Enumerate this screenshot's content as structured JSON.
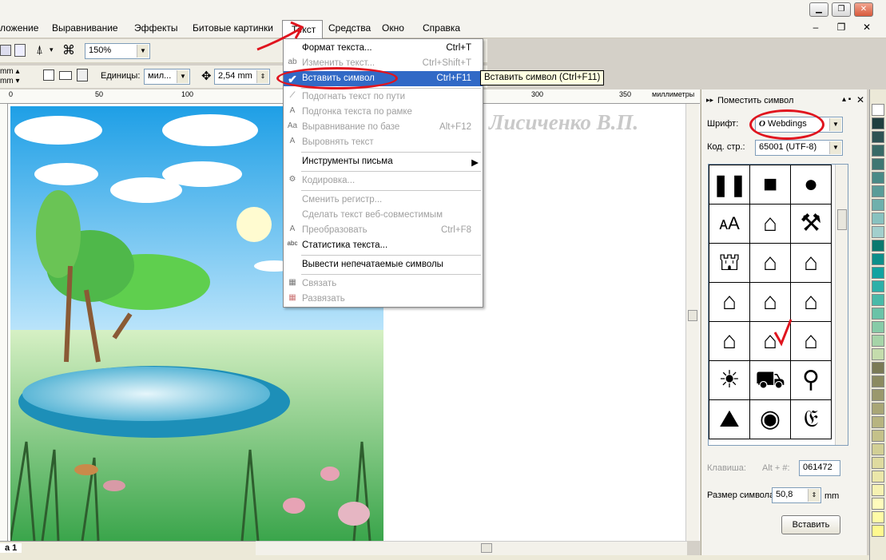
{
  "menubar": {
    "items": [
      "ложение",
      "Выравнивание",
      "Эффекты",
      "Битовые картинки",
      "Текст",
      "Средства",
      "Окно",
      "Справка"
    ]
  },
  "toolbar": {
    "zoom": "150%",
    "units_label": "Единицы:",
    "units_value": "мил...",
    "nudge_value": "2,54 mm"
  },
  "ruler": {
    "labels": [
      "0",
      "50",
      "100",
      "300",
      "350"
    ],
    "unit": "миллиметры"
  },
  "canvas": {
    "watermark": "Лисиченко В.П.",
    "page_tab": "а 1"
  },
  "text_menu": {
    "items": [
      {
        "label": "Формат текста...",
        "shortcut": "Ctrl+T",
        "disabled": false
      },
      {
        "label": "Изменить текст...",
        "shortcut": "Ctrl+Shift+T",
        "disabled": true
      },
      {
        "label": "Вставить символ",
        "shortcut": "Ctrl+F11",
        "highlighted": true
      },
      {
        "label": "Подогнать текст по пути",
        "shortcut": "",
        "disabled": true
      },
      {
        "label": "Подгонка текста по рамке",
        "shortcut": "",
        "disabled": true
      },
      {
        "label": "Выравнивание по базе",
        "shortcut": "Alt+F12",
        "disabled": true
      },
      {
        "label": "Выровнять текст",
        "shortcut": "",
        "disabled": true
      },
      {
        "label": "Инструменты письма",
        "shortcut": "",
        "disabled": false
      },
      {
        "label": "Кодировка...",
        "shortcut": "",
        "disabled": true
      },
      {
        "label": "Сменить регистр...",
        "shortcut": "",
        "disabled": true
      },
      {
        "label": "Сделать текст веб-совместимым",
        "shortcut": "",
        "disabled": true
      },
      {
        "label": "Преобразовать",
        "shortcut": "Ctrl+F8",
        "disabled": true
      },
      {
        "label": "Статистика текста...",
        "shortcut": "",
        "disabled": false
      },
      {
        "label": "Вывести непечатаемые символы",
        "shortcut": "",
        "disabled": false
      },
      {
        "label": "Связать",
        "shortcut": "",
        "disabled": true
      },
      {
        "label": "Развязать",
        "shortcut": "",
        "disabled": true
      }
    ],
    "tooltip": "Вставить символ (Ctrl+F11)"
  },
  "docker": {
    "title": "Поместить символ",
    "font_label": "Шрифт:",
    "font_value": "Webdings",
    "codepage_label": "Код. стр.:",
    "codepage_value": "65001 (UTF-8)",
    "key_label": "Клавиша:",
    "key_alt": "Alt + #:",
    "key_value": "061472",
    "size_label": "Размер символа:",
    "size_value": "50,8",
    "size_unit": "mm",
    "insert_button": "Вставить",
    "symbols": [
      "❚❚",
      "■",
      "●",
      "ᴀA",
      "⌂",
      "⚒",
      "⛫",
      "⌂",
      "⌂",
      "⌂",
      "⌂",
      "⌂",
      "⌂",
      "⌂",
      "⌂",
      "☀",
      "⛟",
      "⚲",
      "⛰",
      "◉",
      "𝔈"
    ]
  },
  "palette": {
    "colors": [
      "#ffffff",
      "#1f3f3f",
      "#2e5353",
      "#386a66",
      "#3f7772",
      "#4a8a86",
      "#5a9c98",
      "#6fb0ac",
      "#88c2bf",
      "#a2cfcc",
      "#0a7a6e",
      "#0d8f8a",
      "#12a3a0",
      "#2cb0a8",
      "#49baa8",
      "#6ac3a7",
      "#87cba7",
      "#a6d4a8",
      "#c4dcac",
      "#7a7a55",
      "#8b8a60",
      "#9a986c",
      "#a9a676",
      "#b7b480",
      "#c4c18a",
      "#d2cf95",
      "#dfdb9f",
      "#ebe7a9",
      "#f6f2b2",
      "#fffcbc",
      "#fffca6",
      "#fff98f"
    ]
  }
}
